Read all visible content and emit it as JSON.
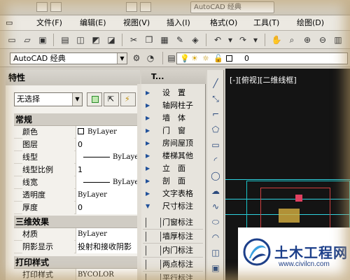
{
  "titlebar": {
    "title": "AutoCAD 经典"
  },
  "menubar": {
    "items": [
      "文件(F)",
      "编辑(E)",
      "视图(V)",
      "插入(I)",
      "格式(O)",
      "工具(T)",
      "绘图(D)"
    ]
  },
  "workspace": {
    "selected": "AutoCAD 经典",
    "layer_value": "0"
  },
  "properties": {
    "title": "特性",
    "selection": "无选择",
    "sections": {
      "general": "常规",
      "three_d": "三维效果",
      "print": "打印样式"
    },
    "general_rows": [
      {
        "name": "颜色",
        "value": "ByLayer"
      },
      {
        "name": "图层",
        "value": "0"
      },
      {
        "name": "线型",
        "value": "ByLayer"
      },
      {
        "name": "线型比例",
        "value": "1"
      },
      {
        "name": "线宽",
        "value": "ByLayer"
      },
      {
        "name": "透明度",
        "value": "ByLayer"
      },
      {
        "name": "厚度",
        "value": "0"
      }
    ],
    "three_d_rows": [
      {
        "name": "材质",
        "value": "ByLayer"
      },
      {
        "name": "阴影显示",
        "value": "投射和接收阴影"
      }
    ],
    "print_rows": [
      {
        "name": "打印样式",
        "value": "BYCOLOR"
      }
    ]
  },
  "tool_palette": {
    "title": "T...",
    "items": [
      "设　置",
      "轴网柱子",
      "墙　体",
      "门　窗",
      "房间屋顶",
      "楼梯其他",
      "立　面",
      "剖　面",
      "文字表格",
      "尺寸标注"
    ],
    "subitems": [
      "门窗标注",
      "墙厚标注",
      "内门标注",
      "两点标注",
      "平行标注"
    ]
  },
  "viewport": {
    "label": "[-][俯视][二维线框]"
  },
  "logo": {
    "name": "土木工程网",
    "url": "www.civilcn.com"
  }
}
